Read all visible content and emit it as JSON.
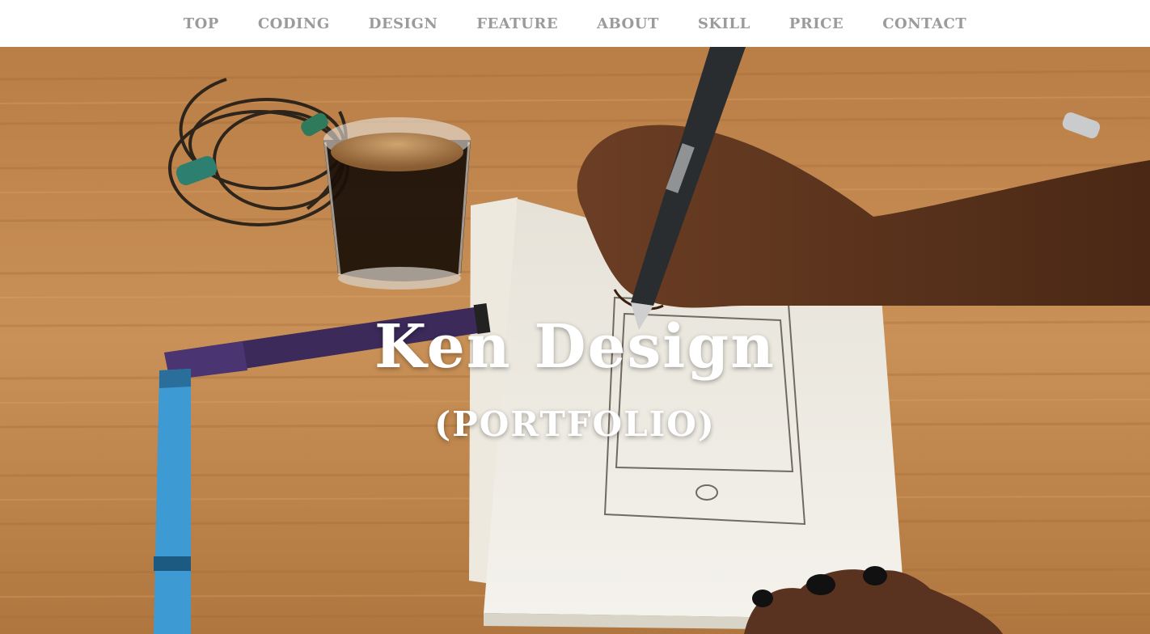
{
  "nav": {
    "items": [
      {
        "label": "TOP"
      },
      {
        "label": "CODING"
      },
      {
        "label": "DESIGN"
      },
      {
        "label": "FEATURE"
      },
      {
        "label": "ABOUT"
      },
      {
        "label": "SKILL"
      },
      {
        "label": "PRICE"
      },
      {
        "label": "CONTACT"
      }
    ]
  },
  "hero": {
    "title": "Ken Design",
    "subtitle": "(PORTFOLIO)",
    "background_image": "photo of a hand sketching a phone wireframe on a notepad on a wooden desk with coffee glass, earphones and markers"
  },
  "colors": {
    "nav_text": "#9b9b9b",
    "nav_background": "#ffffff",
    "hero_text": "#ffffff",
    "wood": "#c08650"
  }
}
